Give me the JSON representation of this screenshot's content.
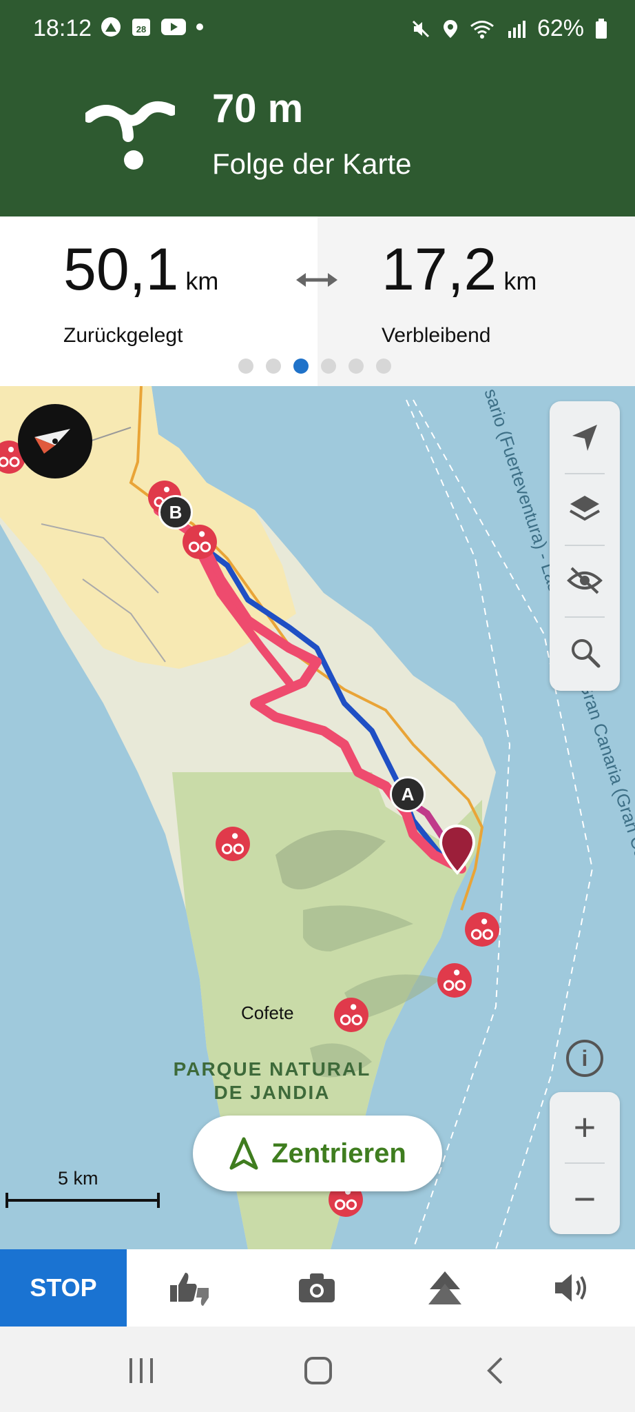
{
  "status_bar": {
    "time": "18:12",
    "calendar_day": "28",
    "battery": "62%"
  },
  "navigation": {
    "distance": "70 m",
    "instruction": "Folge der Karte"
  },
  "stats": {
    "traveled_value": "50,1",
    "traveled_unit": "km",
    "traveled_label": "Zurückgelegt",
    "remaining_value": "17,2",
    "remaining_unit": "km",
    "remaining_label": "Verbleibend",
    "page_count": 6,
    "active_page": 3
  },
  "map": {
    "place_cofete": "Cofete",
    "park_line1": "PARQUE NATURAL",
    "park_line2": "DE JANDIA",
    "ferry_label": "sario (Fuerteventura) - Las Palmas de Gran Canaria (Gran Canaria)",
    "marker_a": "A",
    "marker_b": "B",
    "scale_label": "5 km",
    "center_button": "Zentrieren",
    "zoom_in": "+",
    "zoom_out": "−",
    "info": "i"
  },
  "bottom_bar": {
    "stop_label": "STOP"
  },
  "colors": {
    "header_green": "#2e5a30",
    "accent_blue": "#1a73d2",
    "route_pink": "#ee4b6e",
    "route_blue": "#1f4fc4",
    "button_green": "#3f7d1f"
  }
}
